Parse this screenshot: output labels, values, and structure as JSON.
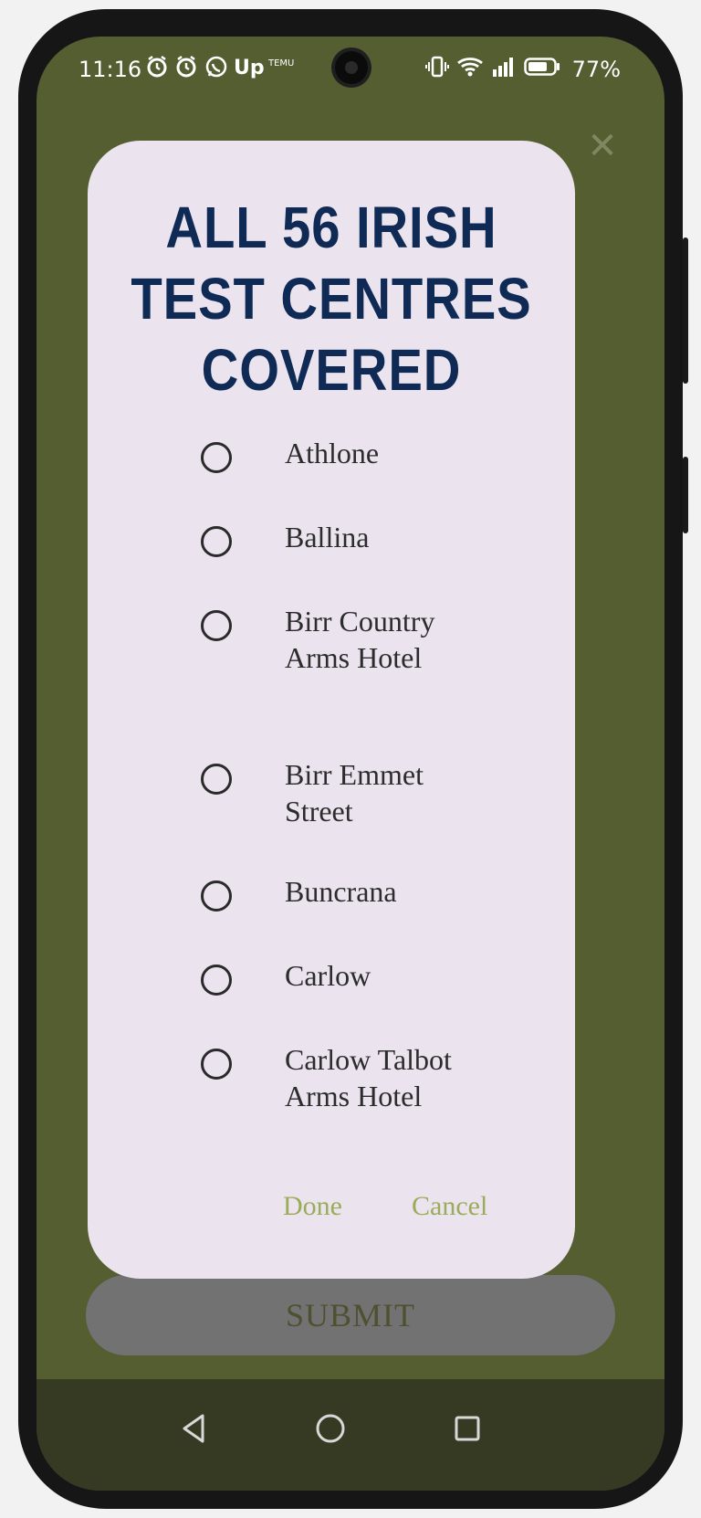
{
  "status_bar": {
    "time": "11:16",
    "icons": [
      "alarm-icon",
      "alarm-icon",
      "whatsapp-icon",
      "up-app-icon",
      "temu-icon"
    ],
    "up_label": "Up",
    "temu_label": "TEMU",
    "right_icons": [
      "vibrate-icon",
      "wifi-icon",
      "signal-icon",
      "battery-icon"
    ],
    "battery_percent": "77%"
  },
  "background": {
    "submit_label": "SUBMIT",
    "close_icon": "close-icon"
  },
  "dialog": {
    "title": "ALL 56 IRISH TEST CENTRES COVERED",
    "options": [
      {
        "label": "Athlone",
        "selected": false
      },
      {
        "label": "Ballina",
        "selected": false
      },
      {
        "label": "Birr Country Arms Hotel",
        "selected": false
      },
      {
        "label": "Birr Emmet Street",
        "selected": false
      },
      {
        "label": "Buncrana",
        "selected": false
      },
      {
        "label": "Carlow",
        "selected": false
      },
      {
        "label": "Carlow Talbot Arms Hotel",
        "selected": false
      }
    ],
    "done_label": "Done",
    "cancel_label": "Cancel",
    "accent_color": "#9aab5a",
    "title_color": "#0f2a55"
  },
  "nav_bar": {
    "icons": [
      "back-icon",
      "home-icon",
      "recents-icon"
    ]
  }
}
